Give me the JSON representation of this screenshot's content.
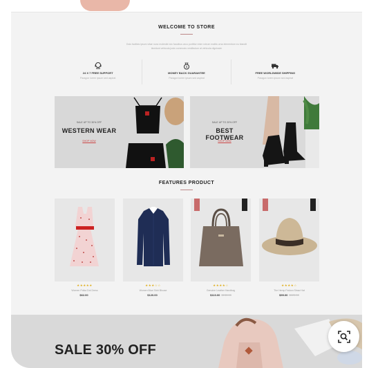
{
  "welcome": {
    "title": "WELCOME TO STORE",
    "lorem_line1": "Duis facilisis ipsum vitae nunc molestie nec faucibus arcu porttitor enim rutrum mattis urna elementum eu blandit",
    "lorem_line2": "tincidunt vehicula justo commodo vestibulum at vehicula dignissim"
  },
  "features": [
    {
      "title": "24 X 7 FREE SUPPORT",
      "sub": "Paragon lorem ipsum sed aspirat",
      "icon": "support-icon"
    },
    {
      "title": "MONEY BACK GUARANTEE",
      "sub": "Paragon lorem ipsum sed aspirat",
      "icon": "money-icon"
    },
    {
      "title": "FREE WORLDWIDE SHIPPING",
      "sub": "Paragon lorem ipsum sed aspirat",
      "icon": "truck-icon"
    }
  ],
  "banners": [
    {
      "sale": "SALE UP TO 30% OFF",
      "title": "WESTERN WEAR",
      "cta": "SHOP NOW"
    },
    {
      "sale": "SALE UP TO 20% OFF",
      "title": "BEST FOOTWEAR",
      "cta": "SHOP NOW"
    }
  ],
  "features_product": {
    "title": "FEATURES PRODUCT",
    "items": [
      {
        "name": "Women Polka Dot Dress",
        "price": "$62.00",
        "old": "",
        "stars": "★★★★★",
        "icon": "dress-icon"
      },
      {
        "name": "Women Blue Shirt Blouse",
        "price": "$120.00",
        "old": "",
        "stars": "★★★☆☆",
        "icon": "shirt-icon"
      },
      {
        "name": "Genuine Leather Handbag",
        "price": "$110.00",
        "old": "$130.00",
        "stars": "★★★★☆",
        "icon": "handbag-icon"
      },
      {
        "name": "The Hemp Fedora Straw Hat",
        "price": "$99.00",
        "old": "$120.00",
        "stars": "★★★★☆",
        "icon": "hat-icon"
      }
    ]
  },
  "sale_band": {
    "text": "SALE 30% OFF"
  },
  "colors": {
    "accent": "#c86b6b",
    "background": "#f3f3f3",
    "banner_bg": "#d8d8d8"
  }
}
